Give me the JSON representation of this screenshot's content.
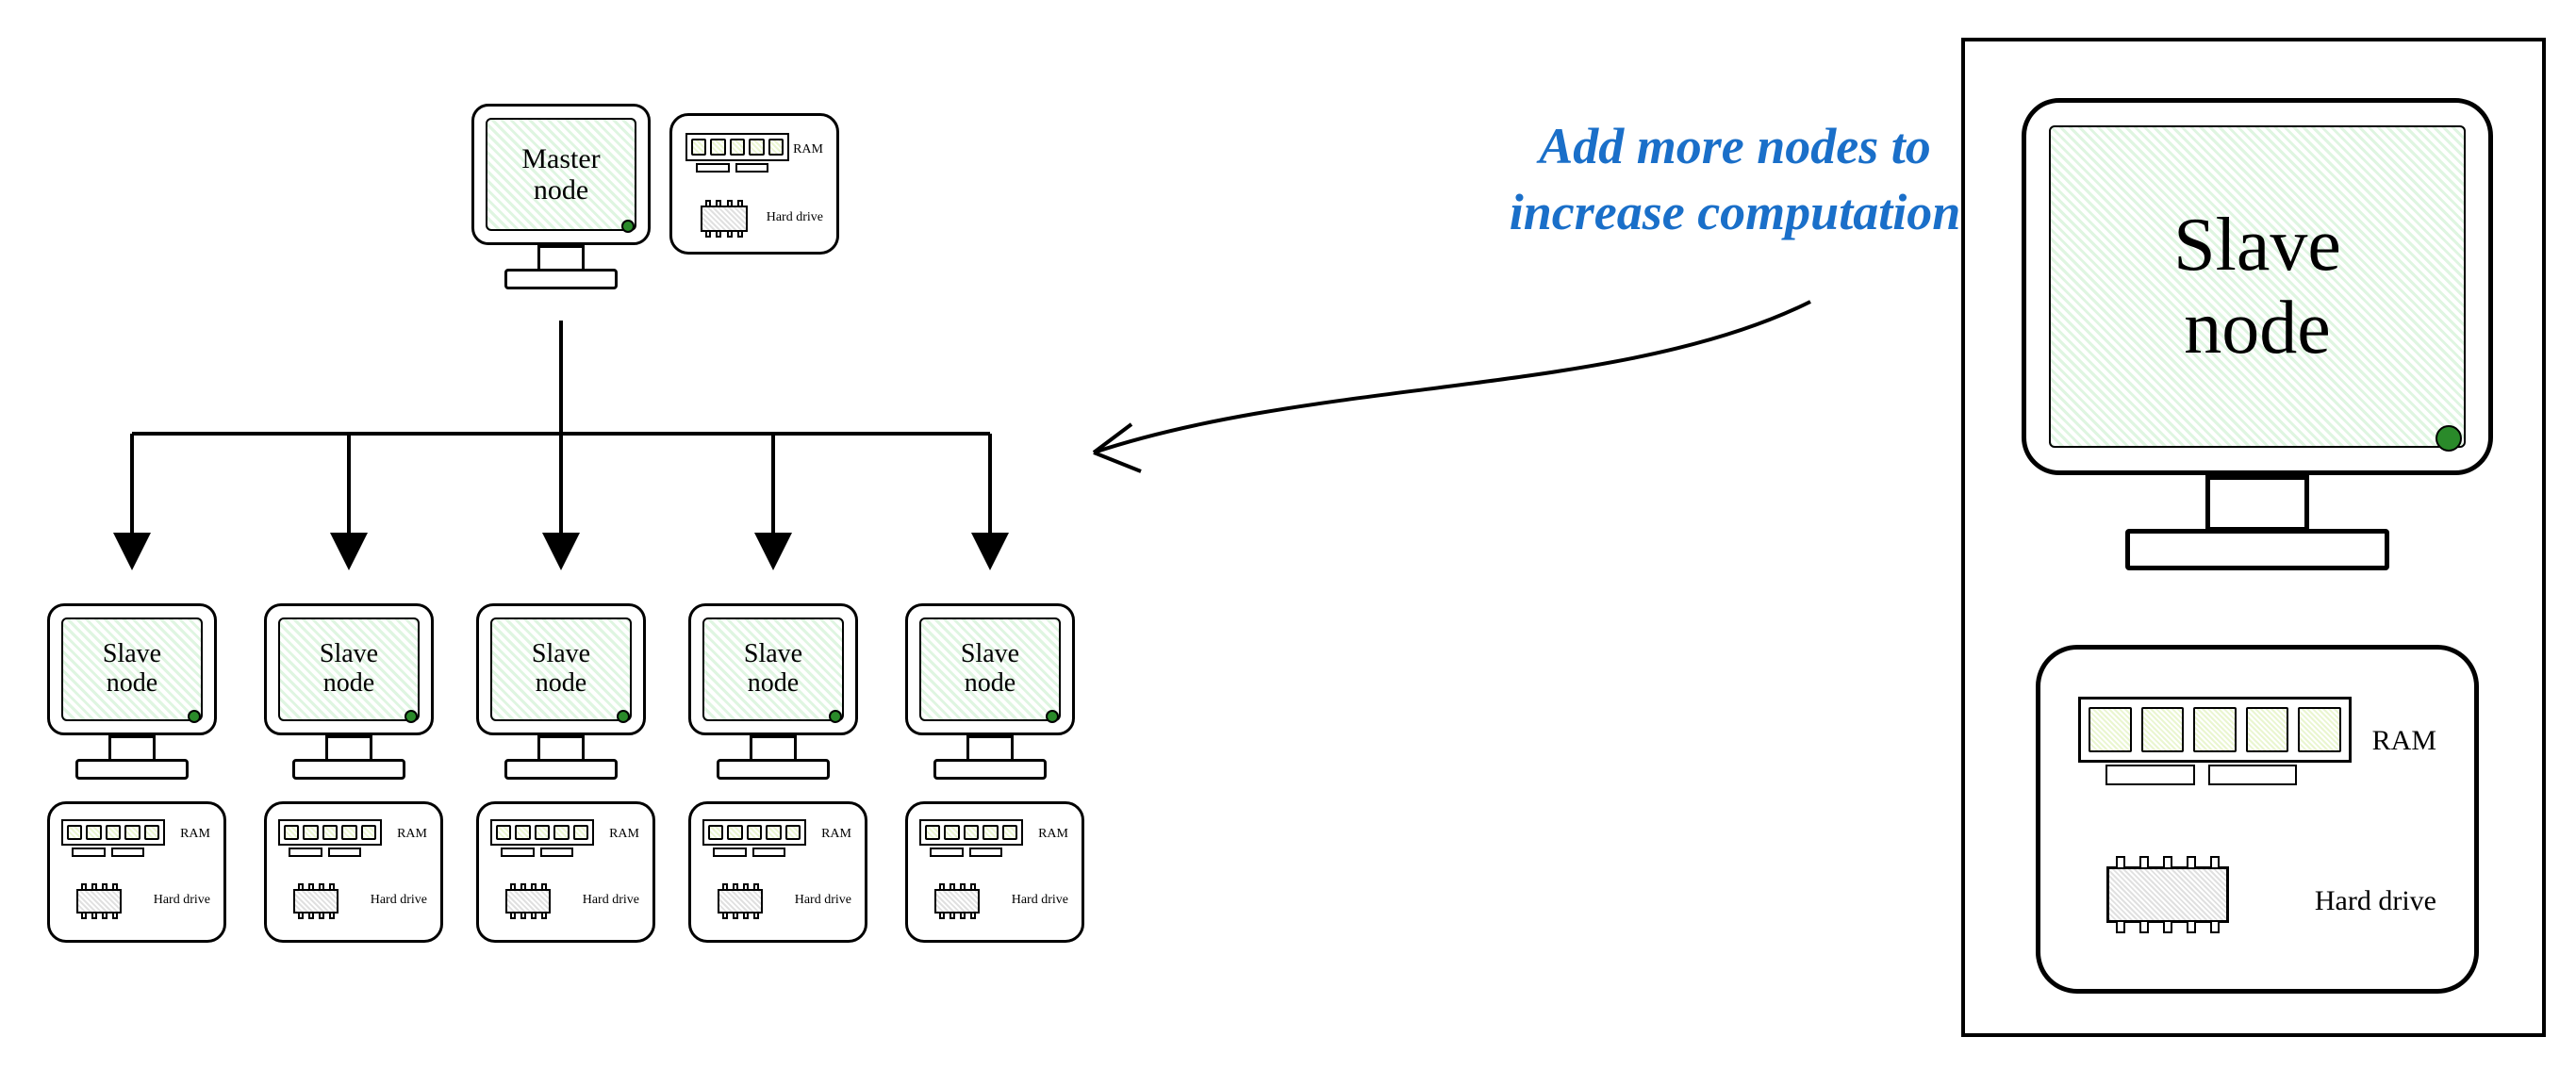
{
  "master": {
    "label1": "Master",
    "label2": "node"
  },
  "slave": {
    "label1": "Slave",
    "label2": "node"
  },
  "hw": {
    "ram": "RAM",
    "hdd": "Hard drive"
  },
  "slaves": [
    {
      "label1": "Slave",
      "label2": "node"
    },
    {
      "label1": "Slave",
      "label2": "node"
    },
    {
      "label1": "Slave",
      "label2": "node"
    },
    {
      "label1": "Slave",
      "label2": "node"
    },
    {
      "label1": "Slave",
      "label2": "node"
    }
  ],
  "callout": {
    "line1": "Add more nodes to",
    "line2": "increase computation"
  },
  "inset": {
    "label1": "Slave",
    "label2": "node",
    "ram": "RAM",
    "hdd": "Hard drive"
  }
}
